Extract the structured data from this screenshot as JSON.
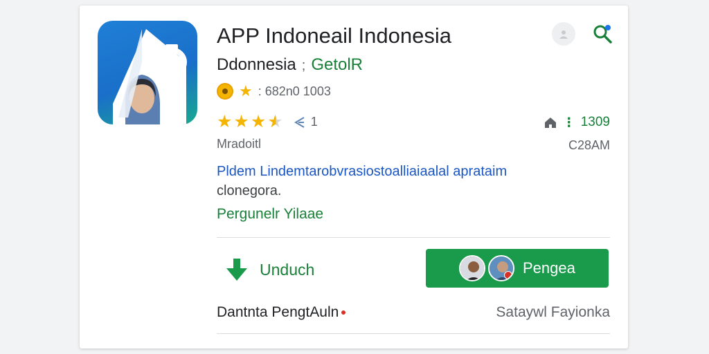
{
  "app": {
    "title": "APP Indoneail Indonesia",
    "developer": "Ddonnesia",
    "separator": ";",
    "publisher": "GetolR",
    "meta_text": ": 682n0 1003",
    "rating_count": "1",
    "category": "Mradoitl",
    "stats_value": "1309",
    "stats_sub": "C28AM",
    "description_link": "Pldem Lindemtarobvrasiostoalliaiaalal aprataim",
    "description_rest": "clonegora.",
    "more_link": "Pergunelr Yilaae"
  },
  "rating": {
    "stars": 3.5
  },
  "actions": {
    "download_label": "Unduch",
    "install_label": "Pengea"
  },
  "footer": {
    "left": "Dantnta PengtAuln",
    "right": "Sataywl Fayionka"
  },
  "colors": {
    "accent_green": "#1a9b4b",
    "link_blue": "#1a56c2",
    "star_yellow": "#f4b400"
  },
  "icons": [
    "app-icon",
    "avatar-icon",
    "search-icon",
    "coin-icon",
    "star-icon",
    "share-icon",
    "house-icon",
    "download-arrow-icon",
    "notification-dot-icon"
  ]
}
